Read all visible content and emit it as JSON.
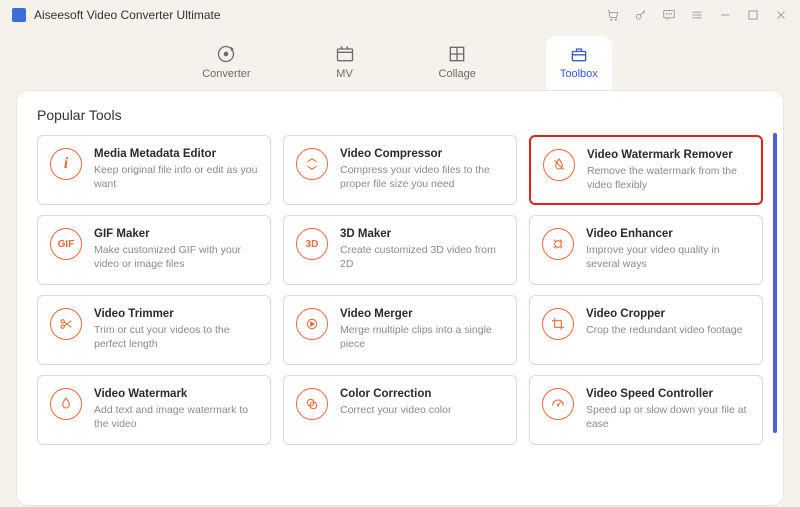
{
  "app": {
    "title": "Aiseesoft Video Converter Ultimate"
  },
  "tabs": [
    {
      "label": "Converter"
    },
    {
      "label": "MV"
    },
    {
      "label": "Collage"
    },
    {
      "label": "Toolbox"
    }
  ],
  "section_title": "Popular Tools",
  "tools": [
    {
      "icon": "info",
      "title": "Media Metadata Editor",
      "desc": "Keep original file info or edit as you want"
    },
    {
      "icon": "compress",
      "title": "Video Compressor",
      "desc": "Compress your video files to the proper file size you need"
    },
    {
      "icon": "nowater",
      "title": "Video Watermark Remover",
      "desc": "Remove the watermark from the video flexibly",
      "highlight": true
    },
    {
      "icon": "gif",
      "title": "GIF Maker",
      "desc": "Make customized GIF with your video or image files"
    },
    {
      "icon": "3d",
      "title": "3D Maker",
      "desc": "Create customized 3D video from 2D"
    },
    {
      "icon": "enhance",
      "title": "Video Enhancer",
      "desc": "Improve your video quality in several ways"
    },
    {
      "icon": "trim",
      "title": "Video Trimmer",
      "desc": "Trim or cut your videos to the perfect length"
    },
    {
      "icon": "merge",
      "title": "Video Merger",
      "desc": "Merge multiple clips into a single piece"
    },
    {
      "icon": "crop",
      "title": "Video Cropper",
      "desc": "Crop the redundant video footage"
    },
    {
      "icon": "water",
      "title": "Video Watermark",
      "desc": "Add text and image watermark to the video"
    },
    {
      "icon": "color",
      "title": "Color Correction",
      "desc": "Correct your video color"
    },
    {
      "icon": "speed",
      "title": "Video Speed Controller",
      "desc": "Speed up or slow down your file at ease"
    }
  ]
}
